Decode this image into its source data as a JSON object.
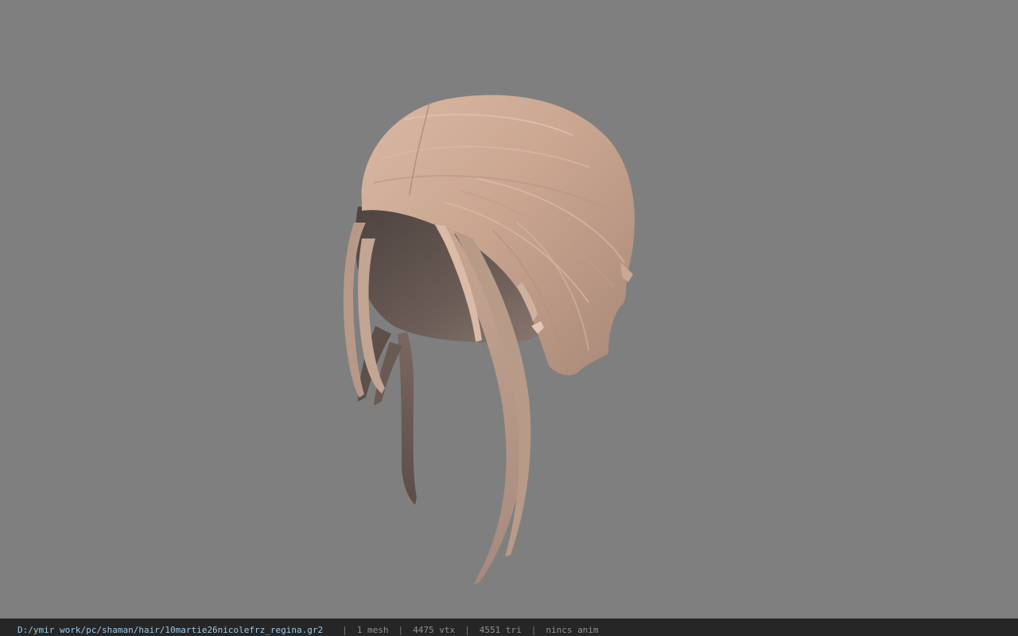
{
  "viewer": {
    "background_color": "#7f7f7f",
    "model_icon": "hair-model"
  },
  "status_bar": {
    "file_path": "D:/ymir work/pc/shaman/hair/10martie26nicolefrz_regina.gr2",
    "separator": "|",
    "mesh_count": "1 mesh",
    "vertex_count": "4475 vtx",
    "triangle_count": "4551 tri",
    "animation_info": "nincs anim"
  }
}
